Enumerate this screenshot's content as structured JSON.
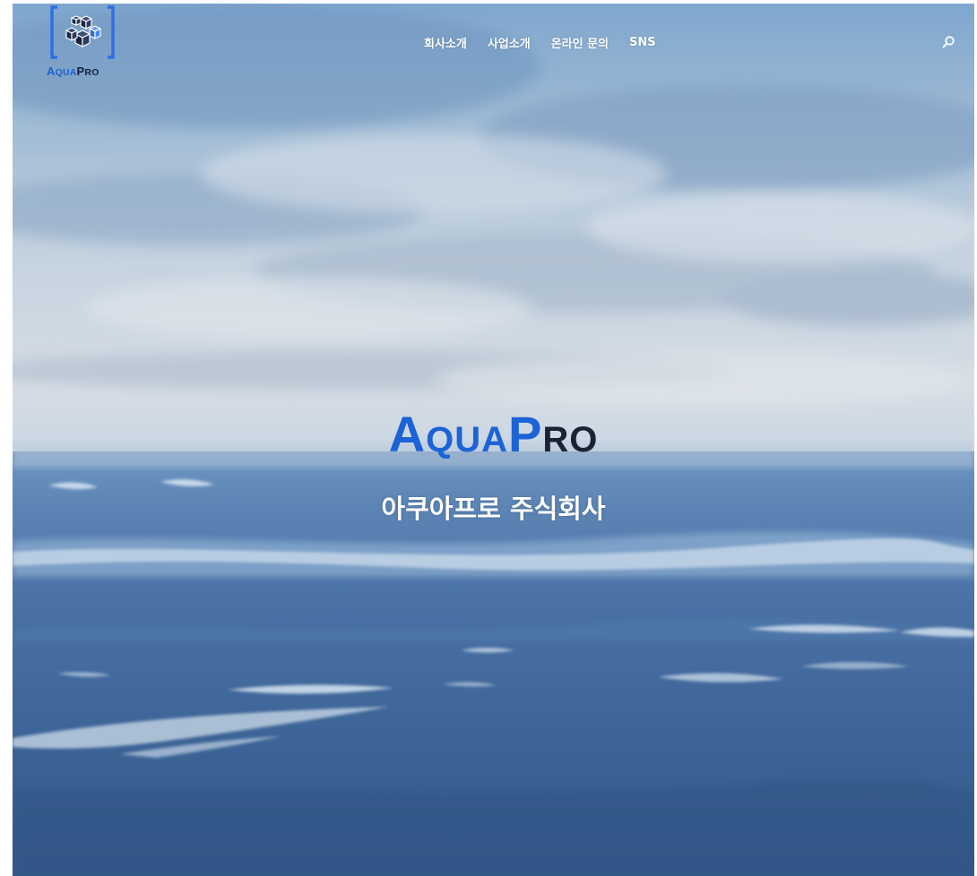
{
  "header": {
    "logo": {
      "text_part1_cap": "A",
      "text_part1_rest": "QUA",
      "text_part2_cap": "P",
      "text_part2_rest": "RO",
      "icon": "cube-blocks-icon",
      "colors": {
        "blue": "#1f5fd0",
        "dark": "#15213d"
      }
    },
    "nav": [
      {
        "label": "회사소개"
      },
      {
        "label": "사업소개"
      },
      {
        "label": "온라인 문의"
      },
      {
        "label": "SNS"
      }
    ],
    "search_icon": "search-icon"
  },
  "hero": {
    "title_part1_cap": "A",
    "title_part1_rest": "QUA",
    "title_part2_cap": "P",
    "title_part2_rest": "RO",
    "subtitle": "아쿠아프로 주식회사",
    "background": "ocean-sky-photo"
  }
}
